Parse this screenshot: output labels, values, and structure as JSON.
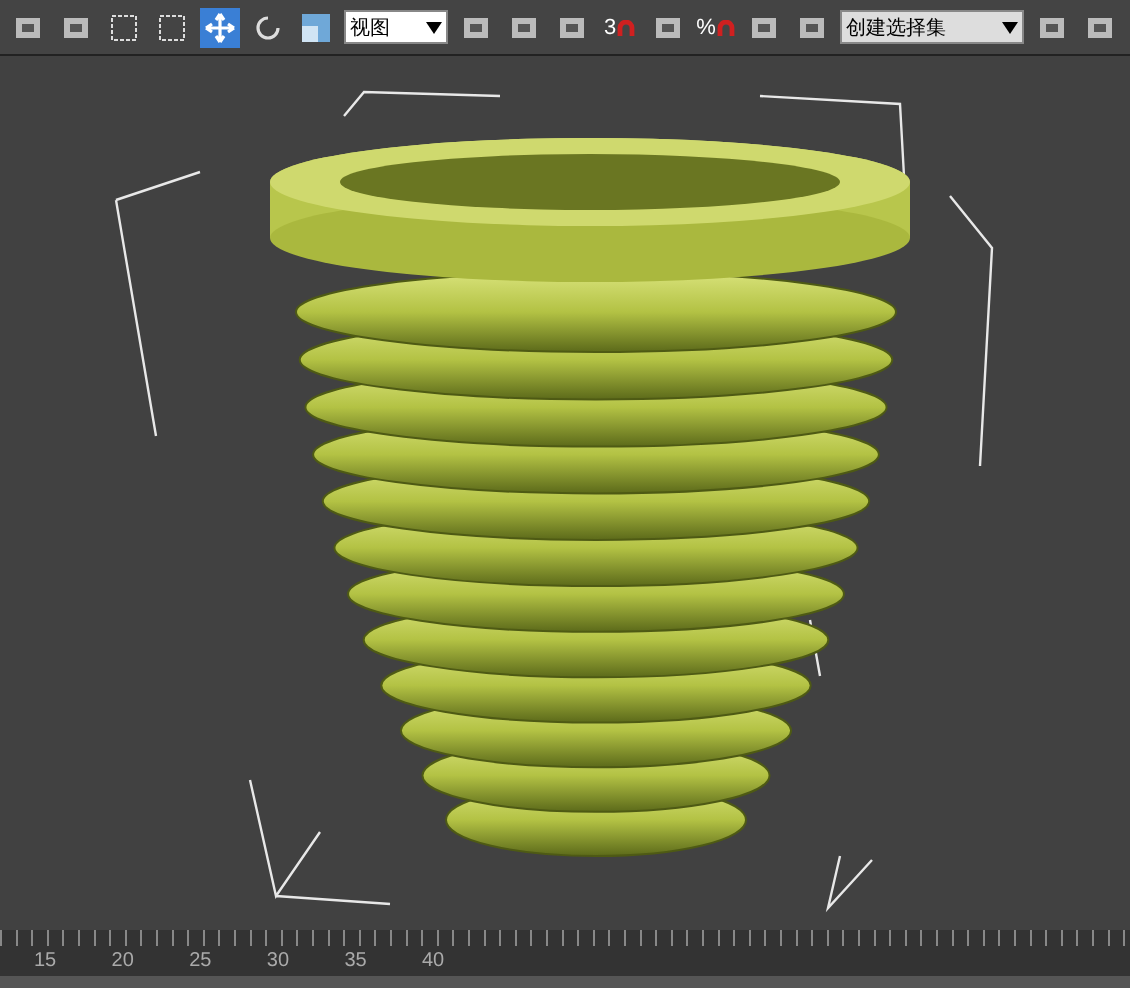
{
  "toolbar": {
    "tools": [
      {
        "kind": "select",
        "selected": false
      },
      {
        "kind": "select-by-name",
        "selected": false
      },
      {
        "kind": "region",
        "selected": false
      },
      {
        "kind": "crossing",
        "selected": false
      },
      {
        "kind": "move",
        "selected": true
      },
      {
        "kind": "rotate",
        "selected": false
      },
      {
        "kind": "scale",
        "selected": false
      },
      {
        "kind": "dropdown",
        "value": "视图"
      },
      {
        "kind": "pivot",
        "selected": false
      },
      {
        "kind": "manipulate",
        "selected": false
      },
      {
        "kind": "keyboard",
        "selected": false
      },
      {
        "kind": "snap",
        "label": "3",
        "selected": false
      },
      {
        "kind": "angle-snap",
        "selected": false
      },
      {
        "kind": "percent-snap",
        "label": "%",
        "selected": false
      },
      {
        "kind": "spinner-snap",
        "selected": false
      },
      {
        "kind": "named-sets",
        "selected": false
      },
      {
        "kind": "dropdown",
        "value": "创建选择集"
      },
      {
        "kind": "mirror",
        "selected": false
      },
      {
        "kind": "align",
        "selected": false
      }
    ]
  },
  "timeline": {
    "ticks": [
      "15",
      "20",
      "25",
      "30",
      "35",
      "40"
    ]
  }
}
